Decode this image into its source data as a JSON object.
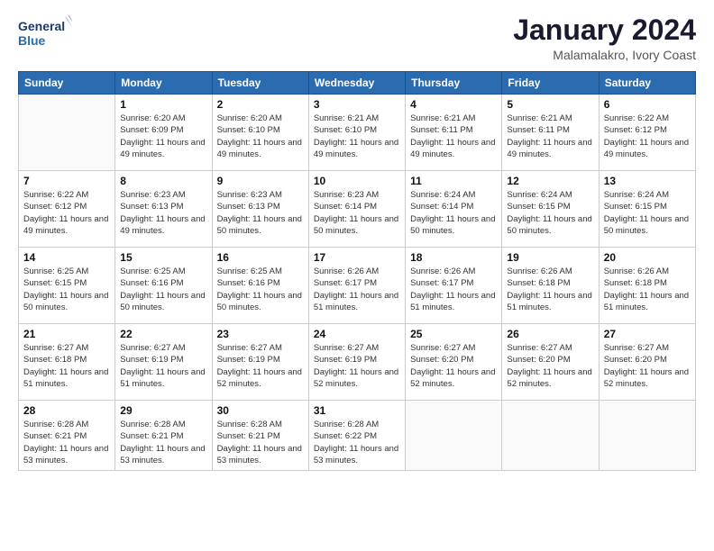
{
  "logo": {
    "line1": "General",
    "line2": "Blue"
  },
  "title": "January 2024",
  "location": "Malamalakro, Ivory Coast",
  "days": [
    "Sunday",
    "Monday",
    "Tuesday",
    "Wednesday",
    "Thursday",
    "Friday",
    "Saturday"
  ],
  "weeks": [
    [
      {
        "num": "",
        "sunrise": "",
        "sunset": "",
        "daylight": "",
        "empty": true
      },
      {
        "num": "1",
        "sunrise": "Sunrise: 6:20 AM",
        "sunset": "Sunset: 6:09 PM",
        "daylight": "Daylight: 11 hours and 49 minutes."
      },
      {
        "num": "2",
        "sunrise": "Sunrise: 6:20 AM",
        "sunset": "Sunset: 6:10 PM",
        "daylight": "Daylight: 11 hours and 49 minutes."
      },
      {
        "num": "3",
        "sunrise": "Sunrise: 6:21 AM",
        "sunset": "Sunset: 6:10 PM",
        "daylight": "Daylight: 11 hours and 49 minutes."
      },
      {
        "num": "4",
        "sunrise": "Sunrise: 6:21 AM",
        "sunset": "Sunset: 6:11 PM",
        "daylight": "Daylight: 11 hours and 49 minutes."
      },
      {
        "num": "5",
        "sunrise": "Sunrise: 6:21 AM",
        "sunset": "Sunset: 6:11 PM",
        "daylight": "Daylight: 11 hours and 49 minutes."
      },
      {
        "num": "6",
        "sunrise": "Sunrise: 6:22 AM",
        "sunset": "Sunset: 6:12 PM",
        "daylight": "Daylight: 11 hours and 49 minutes."
      }
    ],
    [
      {
        "num": "7",
        "sunrise": "Sunrise: 6:22 AM",
        "sunset": "Sunset: 6:12 PM",
        "daylight": "Daylight: 11 hours and 49 minutes."
      },
      {
        "num": "8",
        "sunrise": "Sunrise: 6:23 AM",
        "sunset": "Sunset: 6:13 PM",
        "daylight": "Daylight: 11 hours and 49 minutes."
      },
      {
        "num": "9",
        "sunrise": "Sunrise: 6:23 AM",
        "sunset": "Sunset: 6:13 PM",
        "daylight": "Daylight: 11 hours and 50 minutes."
      },
      {
        "num": "10",
        "sunrise": "Sunrise: 6:23 AM",
        "sunset": "Sunset: 6:14 PM",
        "daylight": "Daylight: 11 hours and 50 minutes."
      },
      {
        "num": "11",
        "sunrise": "Sunrise: 6:24 AM",
        "sunset": "Sunset: 6:14 PM",
        "daylight": "Daylight: 11 hours and 50 minutes."
      },
      {
        "num": "12",
        "sunrise": "Sunrise: 6:24 AM",
        "sunset": "Sunset: 6:15 PM",
        "daylight": "Daylight: 11 hours and 50 minutes."
      },
      {
        "num": "13",
        "sunrise": "Sunrise: 6:24 AM",
        "sunset": "Sunset: 6:15 PM",
        "daylight": "Daylight: 11 hours and 50 minutes."
      }
    ],
    [
      {
        "num": "14",
        "sunrise": "Sunrise: 6:25 AM",
        "sunset": "Sunset: 6:15 PM",
        "daylight": "Daylight: 11 hours and 50 minutes."
      },
      {
        "num": "15",
        "sunrise": "Sunrise: 6:25 AM",
        "sunset": "Sunset: 6:16 PM",
        "daylight": "Daylight: 11 hours and 50 minutes."
      },
      {
        "num": "16",
        "sunrise": "Sunrise: 6:25 AM",
        "sunset": "Sunset: 6:16 PM",
        "daylight": "Daylight: 11 hours and 50 minutes."
      },
      {
        "num": "17",
        "sunrise": "Sunrise: 6:26 AM",
        "sunset": "Sunset: 6:17 PM",
        "daylight": "Daylight: 11 hours and 51 minutes."
      },
      {
        "num": "18",
        "sunrise": "Sunrise: 6:26 AM",
        "sunset": "Sunset: 6:17 PM",
        "daylight": "Daylight: 11 hours and 51 minutes."
      },
      {
        "num": "19",
        "sunrise": "Sunrise: 6:26 AM",
        "sunset": "Sunset: 6:18 PM",
        "daylight": "Daylight: 11 hours and 51 minutes."
      },
      {
        "num": "20",
        "sunrise": "Sunrise: 6:26 AM",
        "sunset": "Sunset: 6:18 PM",
        "daylight": "Daylight: 11 hours and 51 minutes."
      }
    ],
    [
      {
        "num": "21",
        "sunrise": "Sunrise: 6:27 AM",
        "sunset": "Sunset: 6:18 PM",
        "daylight": "Daylight: 11 hours and 51 minutes."
      },
      {
        "num": "22",
        "sunrise": "Sunrise: 6:27 AM",
        "sunset": "Sunset: 6:19 PM",
        "daylight": "Daylight: 11 hours and 51 minutes."
      },
      {
        "num": "23",
        "sunrise": "Sunrise: 6:27 AM",
        "sunset": "Sunset: 6:19 PM",
        "daylight": "Daylight: 11 hours and 52 minutes."
      },
      {
        "num": "24",
        "sunrise": "Sunrise: 6:27 AM",
        "sunset": "Sunset: 6:19 PM",
        "daylight": "Daylight: 11 hours and 52 minutes."
      },
      {
        "num": "25",
        "sunrise": "Sunrise: 6:27 AM",
        "sunset": "Sunset: 6:20 PM",
        "daylight": "Daylight: 11 hours and 52 minutes."
      },
      {
        "num": "26",
        "sunrise": "Sunrise: 6:27 AM",
        "sunset": "Sunset: 6:20 PM",
        "daylight": "Daylight: 11 hours and 52 minutes."
      },
      {
        "num": "27",
        "sunrise": "Sunrise: 6:27 AM",
        "sunset": "Sunset: 6:20 PM",
        "daylight": "Daylight: 11 hours and 52 minutes."
      }
    ],
    [
      {
        "num": "28",
        "sunrise": "Sunrise: 6:28 AM",
        "sunset": "Sunset: 6:21 PM",
        "daylight": "Daylight: 11 hours and 53 minutes."
      },
      {
        "num": "29",
        "sunrise": "Sunrise: 6:28 AM",
        "sunset": "Sunset: 6:21 PM",
        "daylight": "Daylight: 11 hours and 53 minutes."
      },
      {
        "num": "30",
        "sunrise": "Sunrise: 6:28 AM",
        "sunset": "Sunset: 6:21 PM",
        "daylight": "Daylight: 11 hours and 53 minutes."
      },
      {
        "num": "31",
        "sunrise": "Sunrise: 6:28 AM",
        "sunset": "Sunset: 6:22 PM",
        "daylight": "Daylight: 11 hours and 53 minutes."
      },
      {
        "num": "",
        "sunrise": "",
        "sunset": "",
        "daylight": "",
        "empty": true
      },
      {
        "num": "",
        "sunrise": "",
        "sunset": "",
        "daylight": "",
        "empty": true
      },
      {
        "num": "",
        "sunrise": "",
        "sunset": "",
        "daylight": "",
        "empty": true
      }
    ]
  ]
}
